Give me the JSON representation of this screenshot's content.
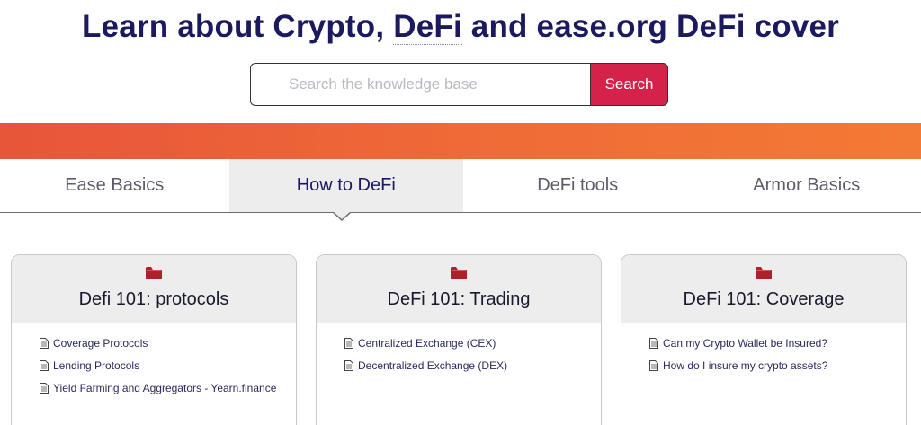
{
  "hero": {
    "title_before": "Learn about Crypto, ",
    "title_link": "DeFi",
    "title_after": " and ease.org DeFi cover"
  },
  "search": {
    "placeholder": "Search the knowledge base",
    "button_label": "Search"
  },
  "tabs": [
    {
      "label": "Ease Basics",
      "active": false
    },
    {
      "label": "How to DeFi",
      "active": true
    },
    {
      "label": "DeFi tools",
      "active": false
    },
    {
      "label": "Armor Basics",
      "active": false
    }
  ],
  "cards": [
    {
      "title": "Defi 101: protocols",
      "articles": [
        "Coverage Protocols",
        "Lending Protocols",
        "Yield Farming and Aggregators - Yearn.finance"
      ]
    },
    {
      "title": "DeFi 101: Trading",
      "articles": [
        "Centralized Exchange (CEX)",
        "Decentralized Exchange (DEX)"
      ]
    },
    {
      "title": "DeFi 101: Coverage",
      "articles": [
        "Can my Crypto Wallet be Insured?",
        "How do I insure my crypto assets?"
      ]
    }
  ],
  "icons": {
    "folder": "folder-icon",
    "article": "document-icon"
  },
  "colors": {
    "accent": "#d3234b",
    "navy": "#1c1a5e",
    "folder": "#b0202a"
  }
}
